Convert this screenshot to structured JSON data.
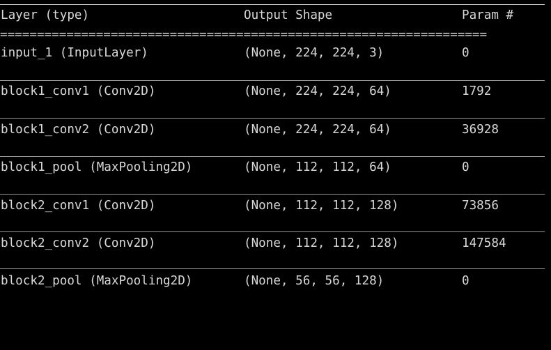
{
  "header": {
    "layer": "Layer (type)",
    "output_shape": "Output Shape",
    "params": "Param #"
  },
  "separator": "==================================================================",
  "rows": [
    {
      "layer": "input_1 (InputLayer)",
      "output_shape": "(None, 224, 224, 3)",
      "params": "0"
    },
    {
      "layer": "block1_conv1 (Conv2D)",
      "output_shape": "(None, 224, 224, 64)",
      "params": "1792"
    },
    {
      "layer": "block1_conv2 (Conv2D)",
      "output_shape": "(None, 224, 224, 64)",
      "params": "36928"
    },
    {
      "layer": "block1_pool (MaxPooling2D)",
      "output_shape": "(None, 112, 112, 64)",
      "params": "0"
    },
    {
      "layer": "block2_conv1 (Conv2D)",
      "output_shape": "(None, 112, 112, 128)",
      "params": "73856"
    },
    {
      "layer": "block2_conv2 (Conv2D)",
      "output_shape": "(None, 112, 112, 128)",
      "params": "147584"
    },
    {
      "layer": "block2_pool (MaxPooling2D)",
      "output_shape": "(None, 56, 56, 128)",
      "params": "0"
    }
  ]
}
